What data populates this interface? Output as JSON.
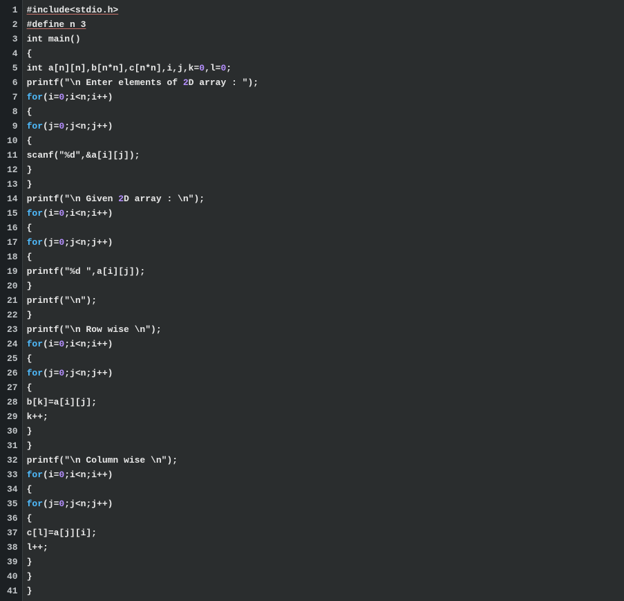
{
  "editor": {
    "lines": [
      {
        "num": "1",
        "tokens": [
          {
            "t": "#include<stdio.h>",
            "c": "plain underline"
          }
        ]
      },
      {
        "num": "2",
        "tokens": [
          {
            "t": "#define n 3",
            "c": "plain underline"
          }
        ]
      },
      {
        "num": "3",
        "tokens": [
          {
            "t": "int main()",
            "c": "plain"
          }
        ]
      },
      {
        "num": "4",
        "tokens": [
          {
            "t": "{",
            "c": "plain"
          }
        ]
      },
      {
        "num": "5",
        "tokens": [
          {
            "t": "int a[n][n],b[n*n],c[n*n],i,j,k=",
            "c": "plain"
          },
          {
            "t": "0",
            "c": "num"
          },
          {
            "t": ",l=",
            "c": "plain"
          },
          {
            "t": "0",
            "c": "num"
          },
          {
            "t": ";",
            "c": "plain"
          }
        ]
      },
      {
        "num": "6",
        "tokens": [
          {
            "t": "printf(\"\\n Enter elements of ",
            "c": "plain"
          },
          {
            "t": "2",
            "c": "num"
          },
          {
            "t": "D array : \");",
            "c": "plain"
          }
        ]
      },
      {
        "num": "7",
        "tokens": [
          {
            "t": "for",
            "c": "kw"
          },
          {
            "t": "(i=",
            "c": "plain"
          },
          {
            "t": "0",
            "c": "num"
          },
          {
            "t": ";i<n;i++)",
            "c": "plain"
          }
        ]
      },
      {
        "num": "8",
        "tokens": [
          {
            "t": "{",
            "c": "plain"
          }
        ]
      },
      {
        "num": "9",
        "tokens": [
          {
            "t": "for",
            "c": "kw"
          },
          {
            "t": "(j=",
            "c": "plain"
          },
          {
            "t": "0",
            "c": "num"
          },
          {
            "t": ";j<n;j++)",
            "c": "plain"
          }
        ]
      },
      {
        "num": "10",
        "tokens": [
          {
            "t": "{",
            "c": "plain"
          }
        ]
      },
      {
        "num": "11",
        "tokens": [
          {
            "t": "scanf(\"%d\",&a[i][j]);",
            "c": "plain"
          }
        ]
      },
      {
        "num": "12",
        "tokens": [
          {
            "t": "}",
            "c": "plain"
          }
        ]
      },
      {
        "num": "13",
        "tokens": [
          {
            "t": "}",
            "c": "plain"
          }
        ]
      },
      {
        "num": "14",
        "tokens": [
          {
            "t": "printf(\"\\n Given ",
            "c": "plain"
          },
          {
            "t": "2",
            "c": "num"
          },
          {
            "t": "D array : \\n\");",
            "c": "plain"
          }
        ]
      },
      {
        "num": "15",
        "tokens": [
          {
            "t": "for",
            "c": "kw"
          },
          {
            "t": "(i=",
            "c": "plain"
          },
          {
            "t": "0",
            "c": "num"
          },
          {
            "t": ";i<n;i++)",
            "c": "plain"
          }
        ]
      },
      {
        "num": "16",
        "tokens": [
          {
            "t": "{",
            "c": "plain"
          }
        ]
      },
      {
        "num": "17",
        "tokens": [
          {
            "t": "for",
            "c": "kw"
          },
          {
            "t": "(j=",
            "c": "plain"
          },
          {
            "t": "0",
            "c": "num"
          },
          {
            "t": ";j<n;j++)",
            "c": "plain"
          }
        ]
      },
      {
        "num": "18",
        "tokens": [
          {
            "t": "{",
            "c": "plain"
          }
        ]
      },
      {
        "num": "19",
        "tokens": [
          {
            "t": "printf(\"%d \",a[i][j]);",
            "c": "plain"
          }
        ]
      },
      {
        "num": "20",
        "tokens": [
          {
            "t": "}",
            "c": "plain"
          }
        ]
      },
      {
        "num": "21",
        "tokens": [
          {
            "t": "printf(\"\\n\");",
            "c": "plain"
          }
        ]
      },
      {
        "num": "22",
        "tokens": [
          {
            "t": "}",
            "c": "plain"
          }
        ]
      },
      {
        "num": "23",
        "tokens": [
          {
            "t": "printf(\"\\n Row wise \\n\");",
            "c": "plain"
          }
        ]
      },
      {
        "num": "24",
        "tokens": [
          {
            "t": "for",
            "c": "kw"
          },
          {
            "t": "(i=",
            "c": "plain"
          },
          {
            "t": "0",
            "c": "num"
          },
          {
            "t": ";i<n;i++)",
            "c": "plain"
          }
        ]
      },
      {
        "num": "25",
        "tokens": [
          {
            "t": "{",
            "c": "plain"
          }
        ]
      },
      {
        "num": "26",
        "tokens": [
          {
            "t": "for",
            "c": "kw"
          },
          {
            "t": "(j=",
            "c": "plain"
          },
          {
            "t": "0",
            "c": "num"
          },
          {
            "t": ";j<n;j++)",
            "c": "plain"
          }
        ]
      },
      {
        "num": "27",
        "tokens": [
          {
            "t": "{",
            "c": "plain"
          }
        ]
      },
      {
        "num": "28",
        "tokens": [
          {
            "t": "b[k]=a[i][j];",
            "c": "plain"
          }
        ]
      },
      {
        "num": "29",
        "tokens": [
          {
            "t": "k++;",
            "c": "plain"
          }
        ]
      },
      {
        "num": "30",
        "tokens": [
          {
            "t": "}",
            "c": "plain"
          }
        ]
      },
      {
        "num": "31",
        "tokens": [
          {
            "t": "}",
            "c": "plain"
          }
        ]
      },
      {
        "num": "32",
        "tokens": [
          {
            "t": "printf(\"\\n Column wise \\n\");",
            "c": "plain"
          }
        ]
      },
      {
        "num": "33",
        "tokens": [
          {
            "t": "for",
            "c": "kw"
          },
          {
            "t": "(i=",
            "c": "plain"
          },
          {
            "t": "0",
            "c": "num"
          },
          {
            "t": ";i<n;i++)",
            "c": "plain"
          }
        ]
      },
      {
        "num": "34",
        "tokens": [
          {
            "t": "{",
            "c": "plain"
          }
        ]
      },
      {
        "num": "35",
        "tokens": [
          {
            "t": "for",
            "c": "kw"
          },
          {
            "t": "(j=",
            "c": "plain"
          },
          {
            "t": "0",
            "c": "num"
          },
          {
            "t": ";j<n;j++)",
            "c": "plain"
          }
        ]
      },
      {
        "num": "36",
        "tokens": [
          {
            "t": "{",
            "c": "plain"
          }
        ]
      },
      {
        "num": "37",
        "tokens": [
          {
            "t": "c[l]=a[j][i];",
            "c": "plain"
          }
        ]
      },
      {
        "num": "38",
        "tokens": [
          {
            "t": "l++;",
            "c": "plain"
          }
        ]
      },
      {
        "num": "39",
        "tokens": [
          {
            "t": "}",
            "c": "plain"
          }
        ]
      },
      {
        "num": "40",
        "tokens": [
          {
            "t": "}",
            "c": "plain"
          }
        ]
      },
      {
        "num": "41",
        "tokens": [
          {
            "t": "}",
            "c": "plain"
          }
        ]
      }
    ]
  }
}
